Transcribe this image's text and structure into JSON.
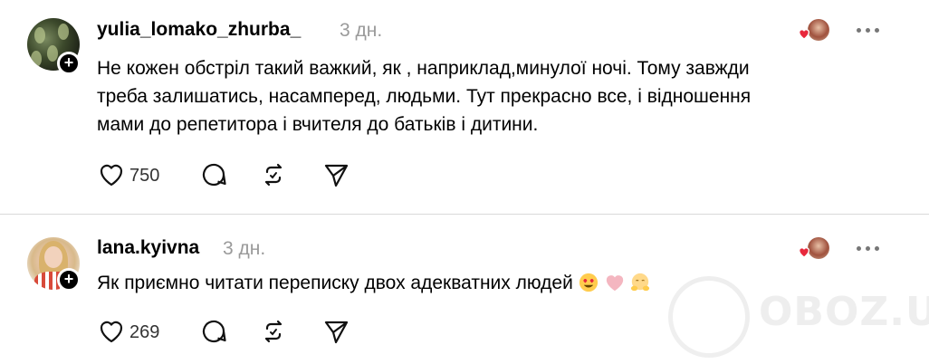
{
  "comments": [
    {
      "username": "yulia_lomako_zhurba_",
      "time": "3 дн.",
      "text_lines": [
        "Не кожен обстріл такий важкий, як , наприклад,минулої ночі. Тому завжди",
        "треба залишатись, насамперед, людьми. Тут прекрасно все, і відношення",
        "мами до репетитора і вчителя до батьків і дитини."
      ],
      "likes": "750",
      "icons": {
        "like": "heart-outline-icon",
        "comment": "speech-bubble-icon",
        "repost": "repost-icon",
        "share": "send-icon"
      }
    },
    {
      "username": "lana.kyivna",
      "time": "3 дн.",
      "text": "Як приємно читати переписку двох адекватних людей",
      "emojis": [
        "heart-eyes-emoji",
        "pink-heart-emoji",
        "hugging-face-emoji"
      ],
      "likes": "269",
      "icons": {
        "like": "heart-outline-icon",
        "comment": "speech-bubble-icon",
        "repost": "repost-icon",
        "share": "send-icon"
      }
    }
  ],
  "watermark": {
    "text": "OBOZ.UA"
  },
  "colors": {
    "username": "#000000",
    "time": "#9a9a9a",
    "divider": "#d9d9d9",
    "heart_red": "#e8283c"
  }
}
